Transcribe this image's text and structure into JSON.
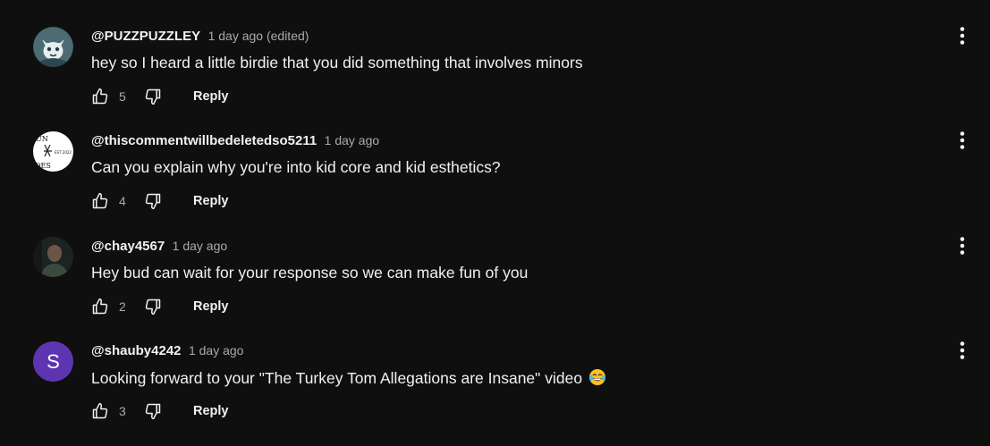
{
  "comments": [
    {
      "author": "@PUZZPUZZLEY",
      "time": "1 day ago (edited)",
      "text": "hey so I heard a little birdie that you did something that involves minors",
      "likes": "5",
      "reply_label": "Reply",
      "avatar_icon": "cat-mask-avatar"
    },
    {
      "author": "@thiscommentwillbedeletedso5211",
      "time": "1 day ago",
      "text": "Can you explain why you're into kid core and kid esthetics?",
      "likes": "4",
      "reply_label": "Reply",
      "avatar_icon": "logo-avatar",
      "avatar_text": [
        "UN",
        "EST 2022",
        "OES"
      ]
    },
    {
      "author": "@chay4567",
      "time": "1 day ago",
      "text": "Hey bud can wait for your response so we can make fun of you",
      "likes": "2",
      "reply_label": "Reply",
      "avatar_icon": "photo-avatar"
    },
    {
      "author": "@shauby4242",
      "time": "1 day ago",
      "text": "Looking forward to your \"The Turkey Tom Allegations are Insane\" video",
      "likes": "3",
      "reply_label": "Reply",
      "avatar_letter": "S",
      "avatar_color": "#5e35b1",
      "emoji_icon": "laughing-tears-emoji"
    }
  ],
  "colors": {
    "background": "#0f0f0f",
    "primary_text": "#f1f1f1",
    "secondary_text": "#aaaaaa"
  }
}
